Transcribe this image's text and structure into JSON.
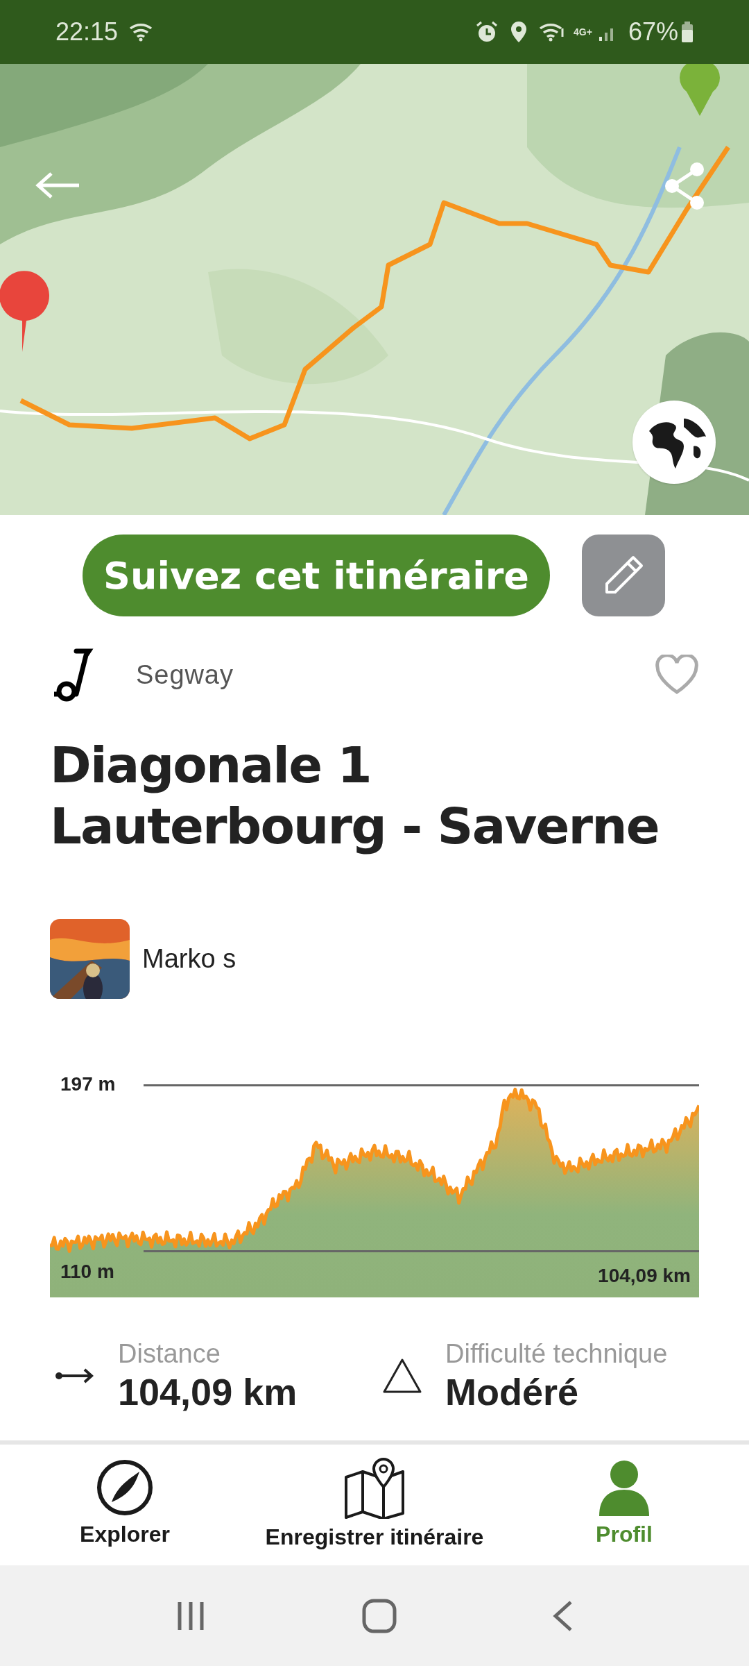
{
  "status_bar": {
    "time": "22:15",
    "network": "4G+",
    "battery": "67%"
  },
  "actions": {
    "follow_button": "Suivez cet itinéraire"
  },
  "activity": {
    "type": "Segway",
    "favorite": false
  },
  "title": [
    "Diagonale 1",
    "Lauterbourg - Saverne"
  ],
  "author": {
    "name": "Marko s"
  },
  "elevation": {
    "max_label": "197 m",
    "min_label": "110 m",
    "distance_label": "104,09 km"
  },
  "stats": [
    {
      "kind": "distance",
      "label": "Distance",
      "value": "104,09 km"
    },
    {
      "kind": "difficulty",
      "label": "Difficulté technique",
      "value": "Modéré"
    }
  ],
  "bottom_nav": [
    {
      "kind": "explore",
      "label": "Explorer",
      "selected": false
    },
    {
      "kind": "record",
      "label": "Enregistrer itinéraire",
      "selected": false
    },
    {
      "kind": "profile",
      "label": "Profil",
      "selected": true
    }
  ]
}
